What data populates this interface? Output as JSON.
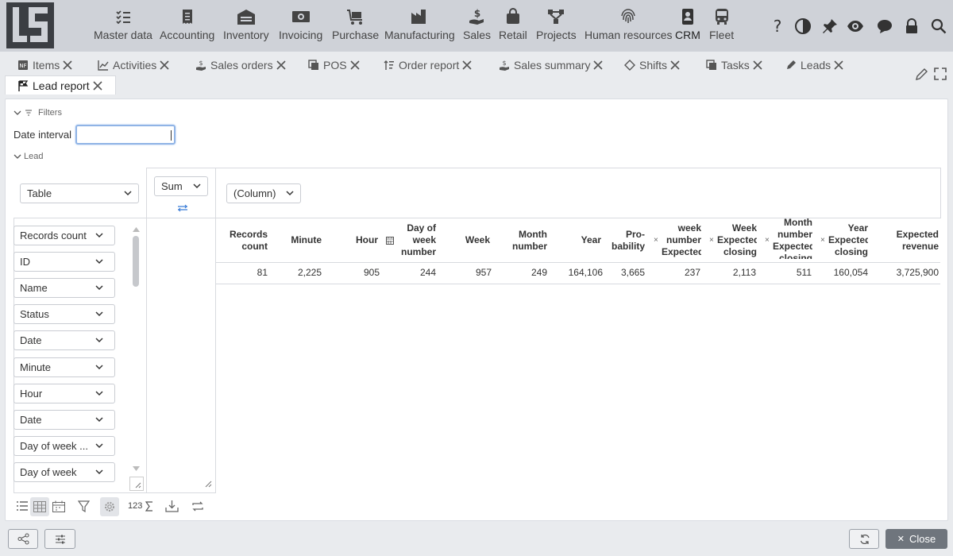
{
  "nav": {
    "items": [
      {
        "label": "Master data",
        "icon": "checklist-icon"
      },
      {
        "label": "Accounting",
        "icon": "receipt-icon"
      },
      {
        "label": "Inventory",
        "icon": "warehouse-icon"
      },
      {
        "label": "Invoicing",
        "icon": "money-icon"
      },
      {
        "label": "Purchase",
        "icon": "cart-icon"
      },
      {
        "label": "Manufacturing",
        "icon": "factory-icon"
      },
      {
        "label": "Sales",
        "icon": "hand-dollar-icon"
      },
      {
        "label": "Retail",
        "icon": "shopping-bag-icon"
      },
      {
        "label": "Projects",
        "icon": "network-icon"
      },
      {
        "label": "Human resources",
        "icon": "fingerprint-icon"
      },
      {
        "label": "CRM",
        "icon": "contact-card-icon"
      },
      {
        "label": "Fleet",
        "icon": "bus-icon"
      }
    ]
  },
  "tabs": [
    {
      "label": "Items"
    },
    {
      "label": "Activities"
    },
    {
      "label": "Sales orders"
    },
    {
      "label": "POS"
    },
    {
      "label": "Order report"
    },
    {
      "label": "Sales summary"
    },
    {
      "label": "Shifts"
    },
    {
      "label": "Tasks"
    },
    {
      "label": "Leads"
    },
    {
      "label": "Lead report"
    }
  ],
  "filters": {
    "section_label": "Filters",
    "date_interval_label": "Date interval",
    "date_interval_value": ""
  },
  "lead": {
    "section_label": "Lead",
    "view_select": "Table",
    "aggregate_select": "Sum",
    "column_select": "(Column)",
    "fields": [
      "Records count",
      "ID",
      "Name",
      "Status",
      "Date",
      "Minute",
      "Hour",
      "Date",
      "Day of week ...",
      "Day of week"
    ]
  },
  "table": {
    "headers": [
      [
        "Records",
        "count"
      ],
      [
        "Minute"
      ],
      [
        "Hour"
      ],
      [
        "Day of",
        "week",
        "number"
      ],
      [
        "Week"
      ],
      [
        "Month",
        "number"
      ],
      [
        "Year"
      ],
      [
        "Pro-",
        "bability"
      ],
      [
        "week",
        "number",
        "Expected"
      ],
      [
        "Week",
        "Expected",
        "closing"
      ],
      [
        "Month",
        "number",
        "Expected",
        "closing"
      ],
      [
        "Year",
        "Expected",
        "closing"
      ],
      [
        "Expected",
        "revenue"
      ]
    ],
    "row": [
      "81",
      "2,225",
      "905",
      "244",
      "957",
      "249",
      "164,106",
      "3,665",
      "237",
      "2,113",
      "511",
      "160,054",
      "3,725,900"
    ]
  },
  "toolbar": {
    "number_label": "123"
  },
  "footer": {
    "close_label": "Close"
  },
  "colors": {
    "topbar": "#cfd2d8",
    "accent": "#90b4e6",
    "close_button": "#6f757d"
  }
}
